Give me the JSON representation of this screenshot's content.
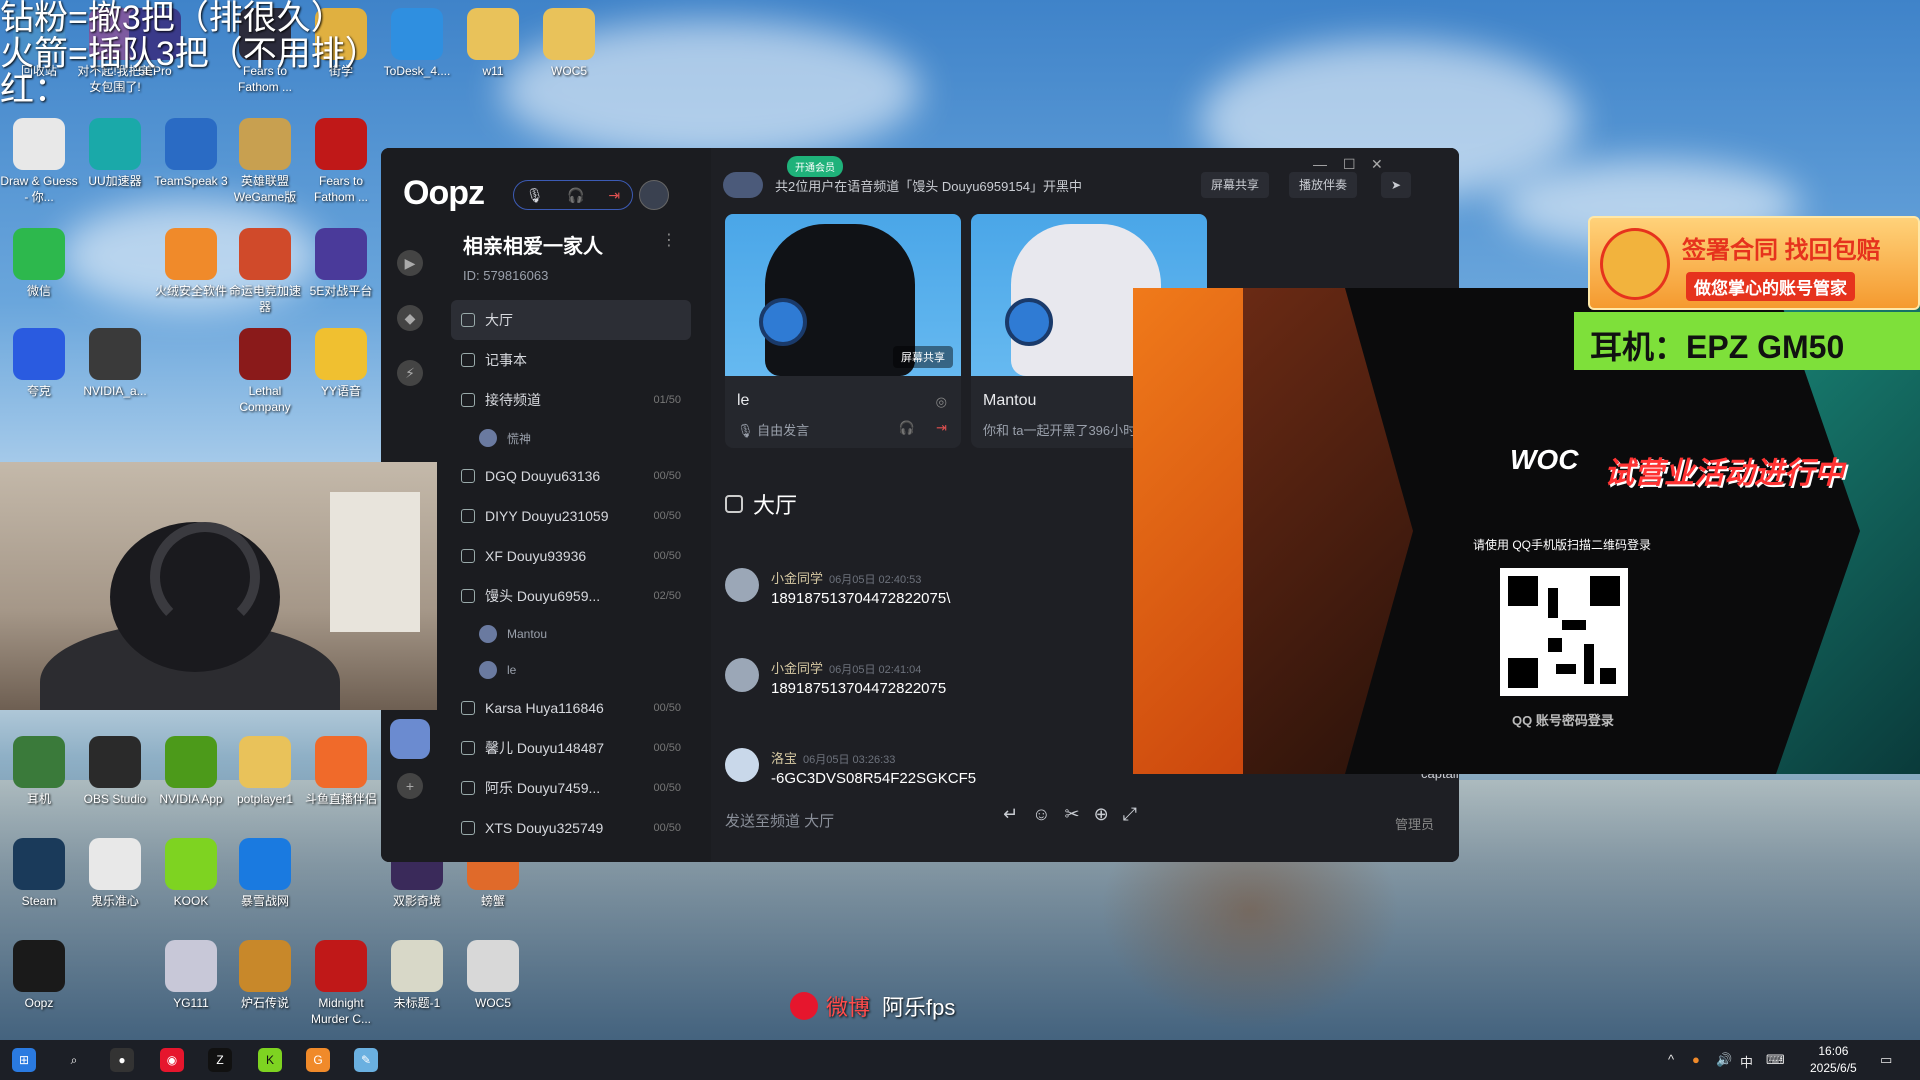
{
  "overlay_lines": [
    "钻粉=撤3把（排很久）",
    "火箭=插队3把（不用排）",
    "红："
  ],
  "desktop_icons": [
    {
      "id": "recycle",
      "label": "回收站",
      "color": "#4a90c8"
    },
    {
      "id": "duibuqi",
      "label": "对不起!我把美女包围了!",
      "color": "#7d5aa0"
    },
    {
      "id": "5epro",
      "label": "5EPro",
      "color": "#3a3a8a"
    },
    {
      "id": "fears1",
      "label": "Fears to Fathom ...",
      "color": "#2b2b3b"
    },
    {
      "id": "folder1",
      "label": "街学",
      "color": "#e0b040"
    },
    {
      "id": "todesk",
      "label": "ToDesk_4....",
      "color": "#2f8fe0"
    },
    {
      "id": "w11",
      "label": "w11",
      "color": "#e9c25a"
    },
    {
      "id": "woc5a",
      "label": "WOC5",
      "color": "#e9c25a"
    },
    {
      "id": "draw",
      "label": "Draw & Guess - 你...",
      "color": "#e8e8e8"
    },
    {
      "id": "uu",
      "label": "UU加速器",
      "color": "#1aa9a9"
    },
    {
      "id": "teamspeak",
      "label": "TeamSpeak 3",
      "color": "#2a6bc4"
    },
    {
      "id": "lol",
      "label": "英雄联盟WeGame版",
      "color": "#c8a050"
    },
    {
      "id": "f2f",
      "label": "Fears to Fathom ...",
      "color": "#c01818"
    },
    {
      "id": "wechat",
      "label": "微信",
      "color": "#2db84d"
    },
    {
      "id": "huorong",
      "label": "火绒安全软件",
      "color": "#f08a2a"
    },
    {
      "id": "fusion",
      "label": "命运电竞加速器",
      "color": "#d04a2a"
    },
    {
      "id": "5e",
      "label": "5E对战平台",
      "color": "#4a3a9a"
    },
    {
      "id": "kuake",
      "label": "夸克",
      "color": "#2a5be0"
    },
    {
      "id": "nvidia1",
      "label": "NVIDIA_a...",
      "color": "#3a3a3a"
    },
    {
      "id": "lethal",
      "label": "Lethal Company",
      "color": "#8a1a1a"
    },
    {
      "id": "yy",
      "label": "YY语音",
      "color": "#f0c030"
    },
    {
      "id": "erji",
      "label": "耳机",
      "color": "#3a7a3a"
    },
    {
      "id": "obs",
      "label": "OBS Studio",
      "color": "#2a2a2a"
    },
    {
      "id": "nvidiaapp",
      "label": "NVIDIA App",
      "color": "#4c9a1a"
    },
    {
      "id": "potplayer",
      "label": "potplayer1",
      "color": "#e9c25a"
    },
    {
      "id": "douyu",
      "label": "斗鱼直播伴侣",
      "color": "#f06a2a"
    },
    {
      "id": "steam",
      "label": "Steam",
      "color": "#1a3a5a"
    },
    {
      "id": "guile",
      "label": "鬼乐准心",
      "color": "#e8e8e8"
    },
    {
      "id": "kook",
      "label": "KOOK",
      "color": "#7ed321"
    },
    {
      "id": "baoxue",
      "label": "暴雪战网",
      "color": "#1a7ae0"
    },
    {
      "id": "shuangying",
      "label": "双影奇境",
      "color": "#3a2a5a"
    },
    {
      "id": "pangxie",
      "label": "螃蟹",
      "color": "#e06a2a"
    },
    {
      "id": "oopz",
      "label": "Oopz",
      "color": "#1a1a1a"
    },
    {
      "id": "yg111",
      "label": "YG111",
      "color": "#c8c8d8"
    },
    {
      "id": "hearth",
      "label": "炉石传说",
      "color": "#c8882a"
    },
    {
      "id": "midnight",
      "label": "Midnight Murder C...",
      "color": "#c01818"
    },
    {
      "id": "untitled",
      "label": "未标题-1",
      "color": "#d8d8c8"
    },
    {
      "id": "woc5b",
      "label": "WOC5",
      "color": "#d8d8d8"
    }
  ],
  "app": {
    "logo": "Oopz",
    "server_name": "相亲相爱一家人",
    "server_id": "ID: 579816063",
    "channels": [
      {
        "name": "大厅",
        "count": "",
        "active": true
      },
      {
        "name": "记事本",
        "count": ""
      },
      {
        "name": "接待频道",
        "count": "01/50"
      },
      {
        "name": "慌神",
        "member": true
      },
      {
        "name": "DGQ Douyu63136",
        "count": "00/50"
      },
      {
        "name": "DIYY Douyu231059",
        "count": "00/50"
      },
      {
        "name": "XF Douyu93936",
        "count": "00/50"
      },
      {
        "name": "馒头 Douyu6959...",
        "count": "02/50"
      },
      {
        "name": "Mantou",
        "member": true
      },
      {
        "name": "le",
        "member": true
      },
      {
        "name": "Karsa Huya116846",
        "count": "00/50"
      },
      {
        "name": "馨儿 Douyu148487",
        "count": "00/50"
      },
      {
        "name": "阿乐 Douyu7459...",
        "count": "00/50"
      },
      {
        "name": "XTS Douyu325749",
        "count": "00/50"
      }
    ],
    "vip_label": "开通会员",
    "voice_header": "共2位用户在语音频道「馒头 Douyu6959154」开黑中",
    "screen_share_btn": "屏幕共享",
    "play_together_btn": "播放伴奏",
    "cards": [
      {
        "name": "le",
        "sub": "自由发言",
        "share": "屏幕共享"
      },
      {
        "name": "Mantou",
        "sub": "你和 ta一起开黑了396小时"
      }
    ],
    "section_title": "大厅",
    "messages": [
      {
        "user": "小金同学",
        "time": "06月05日 02:40:53",
        "text": "189187513704472822075\\"
      },
      {
        "user": "小金同学",
        "time": "06月05日 02:41:04",
        "text": "189187513704472822075"
      },
      {
        "user": "洛宝",
        "time": "06月05日 03:26:33",
        "text": "-6GC3DVS08R54F22SGKCF5"
      }
    ],
    "compose_placeholder": "发送至频道 大厅",
    "members": [
      "captainMo",
      "管理员"
    ]
  },
  "login": {
    "qr_label": "请使用 QQ手机版扫描二维码登录",
    "alt_login": "QQ 账号密码登录",
    "logo_text": "WOC",
    "activity_text": "试营业活动进行中"
  },
  "ads": {
    "top_line1": "签署合同 找回包赔",
    "top_line2": "做您掌心的账号管家",
    "bar": "耳机：EPZ GM50"
  },
  "weibo": {
    "brand": "微博",
    "name": "阿乐fps"
  },
  "taskbar": {
    "time": "16:06",
    "date": "2025/6/5",
    "ime": "中"
  }
}
